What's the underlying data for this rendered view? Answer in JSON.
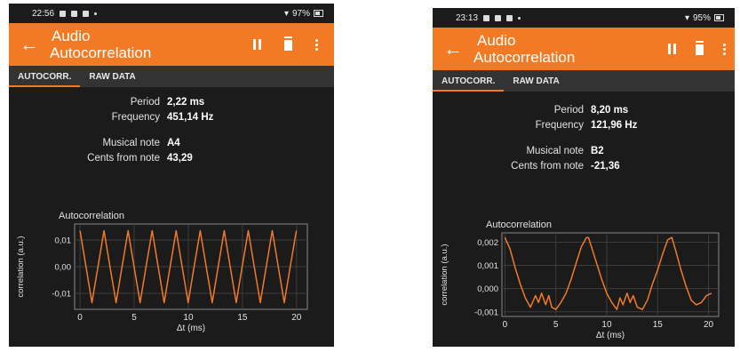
{
  "screens": [
    {
      "status_time": "22:56",
      "status_right": "97%",
      "title_line1": "Audio",
      "title_line2": "Autocorrelation",
      "tabs": [
        "AUTOCORR.",
        "RAW DATA"
      ],
      "period_label": "Period",
      "period_value": "2,22 ms",
      "frequency_label": "Frequency",
      "frequency_value": "451,14 Hz",
      "note_label": "Musical note",
      "note_value": "A4",
      "cents_label": "Cents from note",
      "cents_value": "43,29",
      "plot_title": "Autocorrelation",
      "y_label": "correlation (a.u.)",
      "x_label": "Δt (ms)",
      "y_ticks": [
        "0,01",
        "0,00",
        "-0,01"
      ],
      "x_ticks": [
        "0",
        "5",
        "10",
        "15",
        "20"
      ],
      "chart_data": {
        "type": "line",
        "title": "Autocorrelation",
        "xlabel": "Δt (ms)",
        "ylabel": "correlation (a.u.)",
        "xlim": [
          -0.5,
          21
        ],
        "ylim": [
          -0.016,
          0.016
        ],
        "series_color": "#f07a2a",
        "x": [
          0,
          0.55,
          1.1,
          1.66,
          2.22,
          2.77,
          3.33,
          3.88,
          4.44,
          4.99,
          5.55,
          6.1,
          6.66,
          7.21,
          7.77,
          8.32,
          8.88,
          9.43,
          9.99,
          10.54,
          11.1,
          11.65,
          12.21,
          12.76,
          13.32,
          13.87,
          14.43,
          14.98,
          15.54,
          16.09,
          16.65,
          17.2,
          17.76,
          18.31,
          18.87,
          19.42,
          19.98
        ],
        "y": [
          0.0135,
          0,
          -0.0135,
          0,
          0.0135,
          0,
          -0.0135,
          0,
          0.0135,
          0,
          -0.0135,
          0,
          0.0135,
          0,
          -0.0135,
          0,
          0.0135,
          0,
          -0.0135,
          0,
          0.0135,
          0,
          -0.0135,
          0,
          0.0135,
          0,
          -0.0135,
          0,
          0.0135,
          0,
          -0.0135,
          0,
          0.0135,
          0,
          -0.0135,
          0,
          0.0135
        ]
      }
    },
    {
      "status_time": "23:13",
      "status_right": "95%",
      "title_line1": "Audio",
      "title_line2": "Autocorrelation",
      "tabs": [
        "AUTOCORR.",
        "RAW DATA"
      ],
      "period_label": "Period",
      "period_value": "8,20 ms",
      "frequency_label": "Frequency",
      "frequency_value": "121,96 Hz",
      "note_label": "Musical note",
      "note_value": "B2",
      "cents_label": "Cents from note",
      "cents_value": "-21,36",
      "plot_title": "Autocorrelation",
      "y_label": "correlation (a.u.)",
      "x_label": "Δt (ms)",
      "y_ticks": [
        "0,002",
        "0,001",
        "0,000",
        "-0,001"
      ],
      "x_ticks": [
        "0",
        "5",
        "10",
        "15",
        "20"
      ],
      "chart_data": {
        "type": "line",
        "title": "Autocorrelation",
        "xlabel": "Δt (ms)",
        "ylabel": "correlation (a.u.)",
        "xlim": [
          -0.3,
          21
        ],
        "ylim": [
          -0.0012,
          0.0024
        ],
        "series_color": "#f07a2a",
        "x": [
          0,
          0.5,
          1.0,
          1.5,
          2.0,
          2.5,
          3.0,
          3.3,
          3.6,
          4.0,
          4.3,
          4.6,
          5.0,
          5.5,
          6.0,
          6.5,
          7.0,
          7.5,
          8.0,
          8.2,
          8.5,
          9.0,
          9.5,
          10.0,
          10.5,
          11.0,
          11.3,
          11.6,
          12.0,
          12.3,
          12.6,
          13.0,
          13.5,
          14.0,
          14.5,
          15.0,
          15.5,
          16.0,
          16.4,
          16.8,
          17.3,
          17.8,
          18.3,
          18.8,
          19.3,
          19.8,
          20.3
        ],
        "y": [
          0.0022,
          0.0017,
          0.0009,
          0.0002,
          -0.0004,
          -0.0008,
          -0.0003,
          -0.0006,
          -0.0002,
          -0.0007,
          -0.0003,
          -0.0008,
          -0.0009,
          -0.0006,
          -0.0002,
          0.0004,
          0.0011,
          0.0018,
          0.0022,
          0.0022,
          0.0018,
          0.0011,
          0.0004,
          -0.0002,
          -0.0006,
          -0.0009,
          -0.0004,
          -0.0007,
          -0.0002,
          -0.0006,
          -0.0003,
          -0.0008,
          -0.0009,
          -0.0005,
          0.0002,
          0.0008,
          0.0015,
          0.0021,
          0.0022,
          0.0016,
          0.0008,
          0.0001,
          -0.0005,
          -0.0007,
          -0.0006,
          -0.0003,
          -0.0002
        ]
      }
    }
  ]
}
